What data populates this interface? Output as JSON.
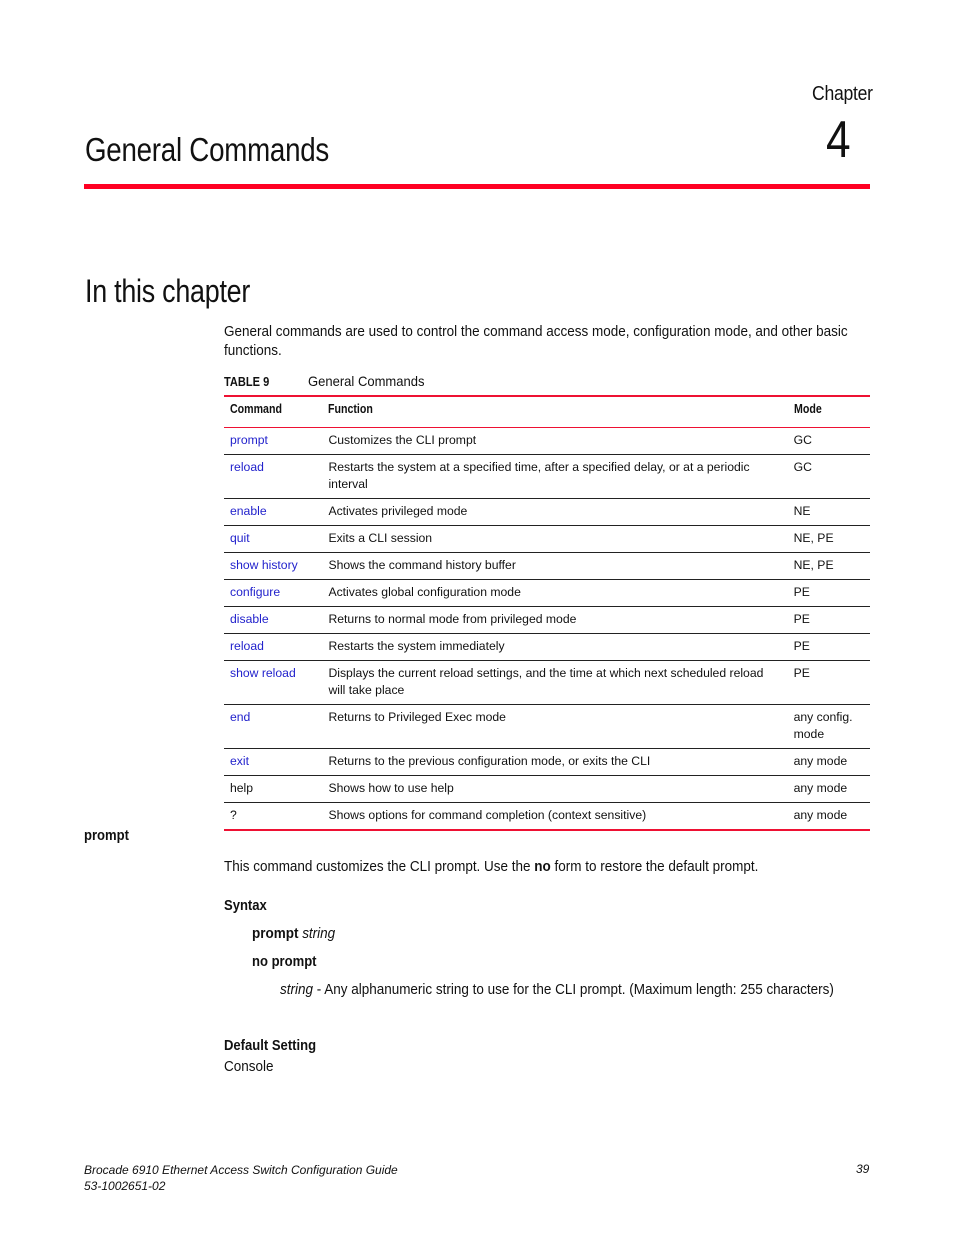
{
  "chapter": {
    "label": "Chapter",
    "number": "4",
    "title": "General Commands"
  },
  "section": {
    "heading": "In this chapter",
    "intro": "General commands are used to control the command access mode, configuration mode, and other basic functions."
  },
  "table": {
    "label": "TABLE 9",
    "title": "General Commands",
    "headers": [
      "Command",
      "Function",
      "Mode"
    ],
    "rows": [
      {
        "command": "prompt",
        "function": "Customizes the CLI prompt",
        "mode": "GC",
        "link": true
      },
      {
        "command": "reload",
        "function": "Restarts the system at a specified time, after a specified delay, or at a periodic interval",
        "mode": "GC",
        "link": true
      },
      {
        "command": "enable",
        "function": "Activates privileged mode",
        "mode": "NE",
        "link": true
      },
      {
        "command": "quit",
        "function": "Exits a CLI session",
        "mode": "NE, PE",
        "link": true
      },
      {
        "command": "show history",
        "function": "Shows the command history buffer",
        "mode": "NE, PE",
        "link": true
      },
      {
        "command": "configure",
        "function": "Activates global configuration mode",
        "mode": "PE",
        "link": true
      },
      {
        "command": "disable",
        "function": "Returns to normal mode from privileged mode",
        "mode": "PE",
        "link": true
      },
      {
        "command": "reload",
        "function": "Restarts the system immediately",
        "mode": "PE",
        "link": true
      },
      {
        "command": "show reload",
        "function": "Displays the current reload settings, and the time at which next scheduled reload will take place",
        "mode": "PE",
        "link": true
      },
      {
        "command": "end",
        "function": "Returns to Privileged Exec mode",
        "mode": "any config. mode",
        "link": true
      },
      {
        "command": "exit",
        "function": "Returns to the previous configuration mode, or exits the CLI",
        "mode": "any mode",
        "link": true
      },
      {
        "command": "help",
        "function": "Shows how to use help",
        "mode": "any mode",
        "link": false
      },
      {
        "command": "?",
        "function": "Shows options for command completion (context sensitive)",
        "mode": "any mode",
        "link": false
      }
    ]
  },
  "prompt_section": {
    "heading": "prompt",
    "desc_before": "This command customizes the CLI prompt. Use the ",
    "desc_bold": "no",
    "desc_after": " form to restore the default prompt.",
    "syntax_heading": "Syntax",
    "syntax_1_cmd": "prompt",
    "syntax_1_arg": "string",
    "syntax_2": "no prompt",
    "param_name": "string",
    "param_desc": " - Any alphanumeric string to use for the CLI prompt. (Maximum length: 255 characters)",
    "default_heading": "Default Setting",
    "default_value": "Console"
  },
  "footer": {
    "title": "Brocade 6910 Ethernet Access Switch Configuration Guide",
    "doc_number": "53-1002651-02",
    "page": "39"
  },
  "colors": {
    "accent_red": "#ff0022",
    "link_blue": "#2222cc"
  }
}
